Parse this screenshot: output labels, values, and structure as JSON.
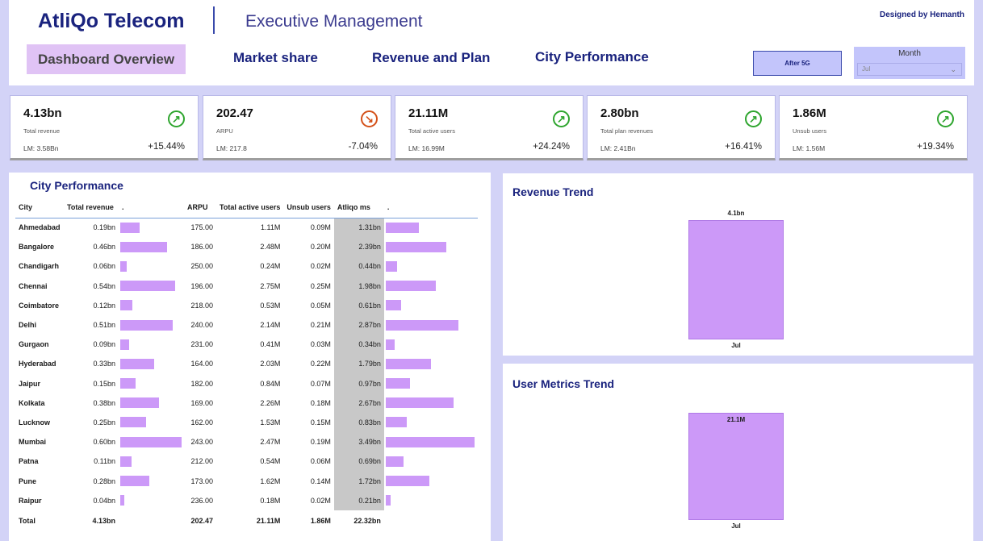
{
  "header": {
    "brand": "AtliQo Telecom",
    "subtitle": "Executive Management",
    "designed_by": "Designed by Hemanth",
    "nav": [
      "Dashboard Overview",
      "Market share",
      "Revenue and Plan",
      "City Performance"
    ],
    "after_5g_label": "After 5G",
    "month_label": "Month",
    "month_value": "Jul"
  },
  "kpis": [
    {
      "value": "4.13bn",
      "label": "Total revenue",
      "lm": "LM: 3.58Bn",
      "change": "+15.44%",
      "trend": "up"
    },
    {
      "value": "202.47",
      "label": "ARPU",
      "lm": "LM: 217.8",
      "change": "-7.04%",
      "trend": "down"
    },
    {
      "value": "21.11M",
      "label": "Total active users",
      "lm": "LM: 16.99M",
      "change": "+24.24%",
      "trend": "up"
    },
    {
      "value": "2.80bn",
      "label": "Total plan revenues",
      "lm": "LM: 2.41Bn",
      "change": "+16.41%",
      "trend": "up"
    },
    {
      "value": "1.86M",
      "label": "Unsub users",
      "lm": "LM: 1.56M",
      "change": "+19.34%",
      "trend": "up"
    }
  ],
  "icons": {
    "up": "arrow-up-right-icon",
    "down": "arrow-down-right-icon"
  },
  "colors": {
    "accent": "#cc99f8",
    "brand": "#1a237e",
    "up": "#2ea52e",
    "down": "#d45119",
    "background": "#d3d3f7"
  },
  "city_table": {
    "title": "City Performance",
    "columns": [
      "City",
      "Total revenue",
      ".",
      "ARPU",
      "Total active users",
      "Unsub users",
      "Atliqo ms",
      "."
    ],
    "rows": [
      {
        "city": "Ahmedabad",
        "revenue": "0.19bn",
        "revenue_val": 0.19,
        "arpu": "175.00",
        "active": "1.11M",
        "unsub": "0.09M",
        "ms": "1.31bn",
        "ms_val": 1.31
      },
      {
        "city": "Bangalore",
        "revenue": "0.46bn",
        "revenue_val": 0.46,
        "arpu": "186.00",
        "active": "2.48M",
        "unsub": "0.20M",
        "ms": "2.39bn",
        "ms_val": 2.39
      },
      {
        "city": "Chandigarh",
        "revenue": "0.06bn",
        "revenue_val": 0.06,
        "arpu": "250.00",
        "active": "0.24M",
        "unsub": "0.02M",
        "ms": "0.44bn",
        "ms_val": 0.44
      },
      {
        "city": "Chennai",
        "revenue": "0.54bn",
        "revenue_val": 0.54,
        "arpu": "196.00",
        "active": "2.75M",
        "unsub": "0.25M",
        "ms": "1.98bn",
        "ms_val": 1.98
      },
      {
        "city": "Coimbatore",
        "revenue": "0.12bn",
        "revenue_val": 0.12,
        "arpu": "218.00",
        "active": "0.53M",
        "unsub": "0.05M",
        "ms": "0.61bn",
        "ms_val": 0.61
      },
      {
        "city": "Delhi",
        "revenue": "0.51bn",
        "revenue_val": 0.51,
        "arpu": "240.00",
        "active": "2.14M",
        "unsub": "0.21M",
        "ms": "2.87bn",
        "ms_val": 2.87
      },
      {
        "city": "Gurgaon",
        "revenue": "0.09bn",
        "revenue_val": 0.09,
        "arpu": "231.00",
        "active": "0.41M",
        "unsub": "0.03M",
        "ms": "0.34bn",
        "ms_val": 0.34
      },
      {
        "city": "Hyderabad",
        "revenue": "0.33bn",
        "revenue_val": 0.33,
        "arpu": "164.00",
        "active": "2.03M",
        "unsub": "0.22M",
        "ms": "1.79bn",
        "ms_val": 1.79
      },
      {
        "city": "Jaipur",
        "revenue": "0.15bn",
        "revenue_val": 0.15,
        "arpu": "182.00",
        "active": "0.84M",
        "unsub": "0.07M",
        "ms": "0.97bn",
        "ms_val": 0.97
      },
      {
        "city": "Kolkata",
        "revenue": "0.38bn",
        "revenue_val": 0.38,
        "arpu": "169.00",
        "active": "2.26M",
        "unsub": "0.18M",
        "ms": "2.67bn",
        "ms_val": 2.67
      },
      {
        "city": "Lucknow",
        "revenue": "0.25bn",
        "revenue_val": 0.25,
        "arpu": "162.00",
        "active": "1.53M",
        "unsub": "0.15M",
        "ms": "0.83bn",
        "ms_val": 0.83
      },
      {
        "city": "Mumbai",
        "revenue": "0.60bn",
        "revenue_val": 0.6,
        "arpu": "243.00",
        "active": "2.47M",
        "unsub": "0.19M",
        "ms": "3.49bn",
        "ms_val": 3.49
      },
      {
        "city": "Patna",
        "revenue": "0.11bn",
        "revenue_val": 0.11,
        "arpu": "212.00",
        "active": "0.54M",
        "unsub": "0.06M",
        "ms": "0.69bn",
        "ms_val": 0.69
      },
      {
        "city": "Pune",
        "revenue": "0.28bn",
        "revenue_val": 0.28,
        "arpu": "173.00",
        "active": "1.62M",
        "unsub": "0.14M",
        "ms": "1.72bn",
        "ms_val": 1.72
      },
      {
        "city": "Raipur",
        "revenue": "0.04bn",
        "revenue_val": 0.04,
        "arpu": "236.00",
        "active": "0.18M",
        "unsub": "0.02M",
        "ms": "0.21bn",
        "ms_val": 0.21
      }
    ],
    "total": {
      "city": "Total",
      "revenue": "4.13bn",
      "arpu": "202.47",
      "active": "21.11M",
      "unsub": "1.86M",
      "ms": "22.32bn"
    }
  },
  "chart_data": [
    {
      "type": "bar",
      "title": "Revenue Trend",
      "categories": [
        "Jul"
      ],
      "values": [
        4.1
      ],
      "value_labels": [
        "4.1bn"
      ],
      "ylim": [
        0,
        4.1
      ]
    },
    {
      "type": "bar",
      "title": "User Metrics Trend",
      "categories": [
        "Jul"
      ],
      "values": [
        21.1
      ],
      "value_labels": [
        "21.1M"
      ],
      "ylim": [
        0,
        21.1
      ]
    }
  ]
}
